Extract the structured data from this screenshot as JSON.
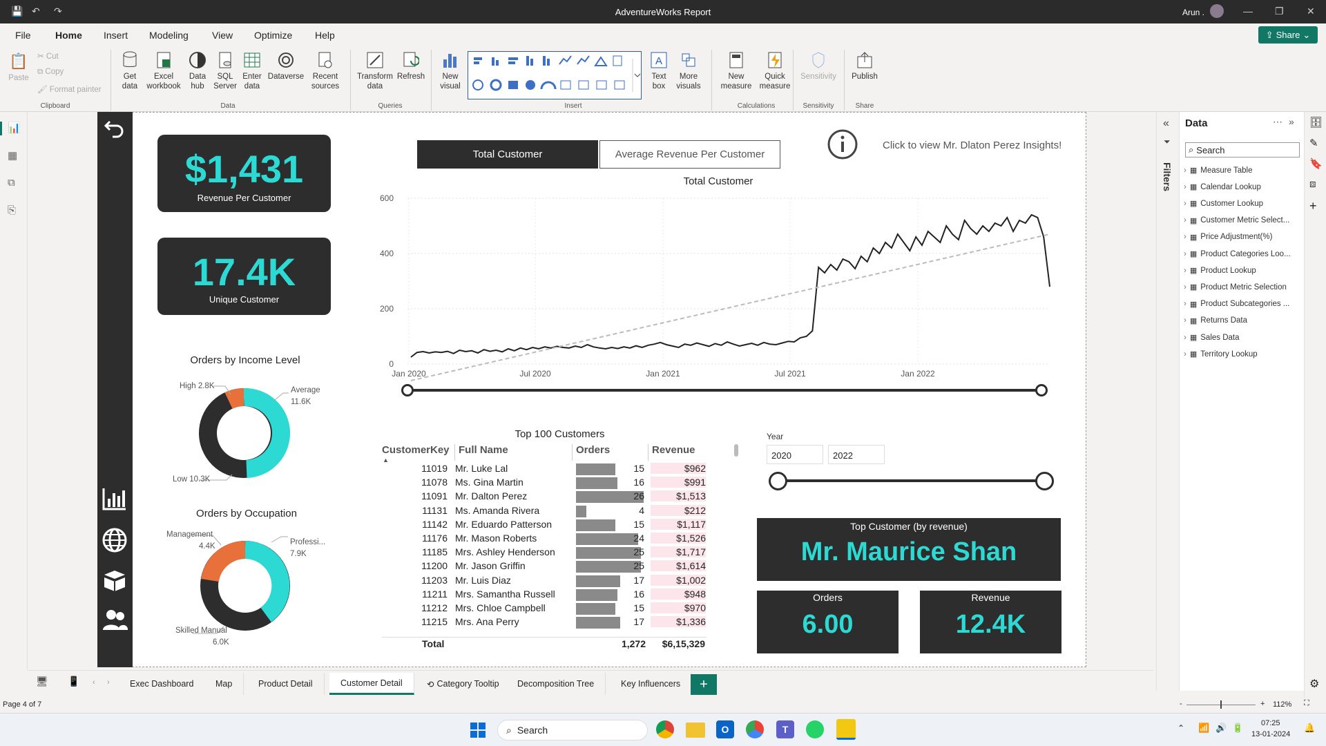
{
  "window": {
    "title": "AdventureWorks Report",
    "user": "Arun ."
  },
  "menu": {
    "items": [
      "File",
      "Home",
      "Insert",
      "Modeling",
      "View",
      "Optimize",
      "Help"
    ],
    "active": "Home",
    "share": "Share"
  },
  "ribbon": {
    "clipboard": {
      "paste": "Paste",
      "cut": "Cut",
      "copy": "Copy",
      "format_painter": "Format painter",
      "group": "Clipboard"
    },
    "data": {
      "get_data": "Get data",
      "excel": "Excel workbook",
      "data_hub": "Data hub",
      "sql": "SQL Server",
      "enter": "Enter data",
      "dataverse": "Dataverse",
      "recent": "Recent sources",
      "group": "Data"
    },
    "queries": {
      "transform": "Transform data",
      "refresh": "Refresh",
      "group": "Queries"
    },
    "insert": {
      "new_visual": "New visual",
      "text_box": "Text box",
      "more_visuals": "More visuals",
      "group": "Insert"
    },
    "calculations": {
      "new_measure": "New measure",
      "quick_measure": "Quick measure",
      "group": "Calculations"
    },
    "sensitivity": {
      "label": "Sensitivity",
      "group": "Sensitivity"
    },
    "share": {
      "publish": "Publish",
      "group": "Share"
    }
  },
  "kpis": {
    "revenue_per_customer": {
      "value": "$1,431",
      "label": "Revenue Per Customer"
    },
    "unique_customer": {
      "value": "17.4K",
      "label": "Unique Customer"
    }
  },
  "toggle": {
    "active": "Total Customer",
    "inactive": "Average Revenue Per Customer"
  },
  "insight_text": "Click to view Mr. Dlaton Perez Insights!",
  "donut_income": {
    "title": "Orders by Income Level",
    "labels": {
      "high": "High 2.8K",
      "avg1": "Average",
      "avg2": "11.6K",
      "low": "Low 10.3K"
    }
  },
  "donut_occupation": {
    "title": "Orders by Occupation",
    "labels": {
      "mgmt1": "Management",
      "mgmt2": "4.4K",
      "prof1": "Professi...",
      "prof2": "7.9K",
      "skill1": "Skilled Manual",
      "skill2": "6.0K"
    }
  },
  "chart_data": {
    "type": "line",
    "title": "Total Customer",
    "ylim": [
      0,
      600
    ],
    "yticks": [
      "600",
      "400",
      "200",
      "0"
    ],
    "xticks": [
      "Jan 2020",
      "Jul 2020",
      "Jan 2021",
      "Jul 2021",
      "Jan 2022"
    ],
    "series": [
      {
        "values": [
          25,
          42,
          45,
          40,
          44,
          42,
          46,
          38,
          50,
          45,
          48,
          40,
          52,
          46,
          50,
          44,
          55,
          48,
          58,
          52,
          60,
          55,
          62,
          58,
          64,
          60,
          58,
          65,
          60,
          70,
          62,
          58,
          55,
          60,
          56,
          62,
          58,
          66,
          60,
          68,
          72,
          78,
          70,
          65,
          60,
          72,
          68,
          76,
          70,
          64,
          74,
          68,
          80,
          72,
          65,
          70,
          75,
          68,
          78,
          72,
          70,
          76,
          82,
          80,
          95,
          100,
          120,
          350,
          330,
          360,
          340,
          380,
          370,
          345,
          390,
          370,
          420,
          400,
          440,
          420,
          470,
          440,
          410,
          460,
          430,
          480,
          460,
          440,
          500,
          470,
          450,
          520,
          490,
          470,
          500,
          480,
          510,
          500,
          530,
          480,
          520,
          510,
          540,
          530,
          460,
          280
        ]
      },
      {
        "values": [
          -60,
          470
        ]
      }
    ]
  },
  "table": {
    "title": "Top 100 Customers",
    "headers": [
      "CustomerKey",
      "Full Name",
      "Orders",
      "Revenue"
    ],
    "rows": [
      {
        "key": "11019",
        "name": "Mr. Luke Lal",
        "orders": 15,
        "revenue": "$962"
      },
      {
        "key": "11078",
        "name": "Ms. Gina Martin",
        "orders": 16,
        "revenue": "$991"
      },
      {
        "key": "11091",
        "name": "Mr. Dalton Perez",
        "orders": 26,
        "revenue": "$1,513"
      },
      {
        "key": "11131",
        "name": "Ms. Amanda Rivera",
        "orders": 4,
        "revenue": "$212"
      },
      {
        "key": "11142",
        "name": "Mr. Eduardo Patterson",
        "orders": 15,
        "revenue": "$1,117"
      },
      {
        "key": "11176",
        "name": "Mr. Mason Roberts",
        "orders": 24,
        "revenue": "$1,526"
      },
      {
        "key": "11185",
        "name": "Mrs. Ashley Henderson",
        "orders": 25,
        "revenue": "$1,717"
      },
      {
        "key": "11200",
        "name": "Mr. Jason Griffin",
        "orders": 25,
        "revenue": "$1,614"
      },
      {
        "key": "11203",
        "name": "Mr. Luis Diaz",
        "orders": 17,
        "revenue": "$1,002"
      },
      {
        "key": "11211",
        "name": "Mrs. Samantha Russell",
        "orders": 16,
        "revenue": "$948"
      },
      {
        "key": "11212",
        "name": "Mrs. Chloe Campbell",
        "orders": 15,
        "revenue": "$970"
      },
      {
        "key": "11215",
        "name": "Mrs. Ana Perry",
        "orders": 17,
        "revenue": "$1,336"
      }
    ],
    "total": {
      "label": "Total",
      "orders": "1,272",
      "revenue": "$6,15,329"
    }
  },
  "year_slicer": {
    "title": "Year",
    "from": "2020",
    "to": "2022"
  },
  "top_customer": {
    "title": "Top Customer (by revenue)",
    "name": "Mr. Maurice Shan",
    "orders_label": "Orders",
    "orders_value": "6.00",
    "revenue_label": "Revenue",
    "revenue_value": "12.4K"
  },
  "tabs": [
    "Exec Dashboard",
    "Map",
    "Product Detail",
    "Customer Detail",
    "Category Tooltip",
    "Decomposition Tree",
    "Key Influencers"
  ],
  "active_tab": "Customer Detail",
  "status": {
    "page": "Page 4 of 7",
    "zoom": "112%"
  },
  "datapane": {
    "title": "Data",
    "filters": "Filters",
    "search_placeholder": "Search",
    "fields": [
      "Measure Table",
      "Calendar Lookup",
      "Customer Lookup",
      "Customer Metric Select...",
      "Price Adjustment(%)",
      "Product Categories Loo...",
      "Product Lookup",
      "Product Metric Selection",
      "Product Subcategories ...",
      "Returns Data",
      "Sales Data",
      "Territory Lookup"
    ]
  },
  "taskbar": {
    "search": "Search",
    "time": "07:25",
    "date": "13-01-2024"
  }
}
